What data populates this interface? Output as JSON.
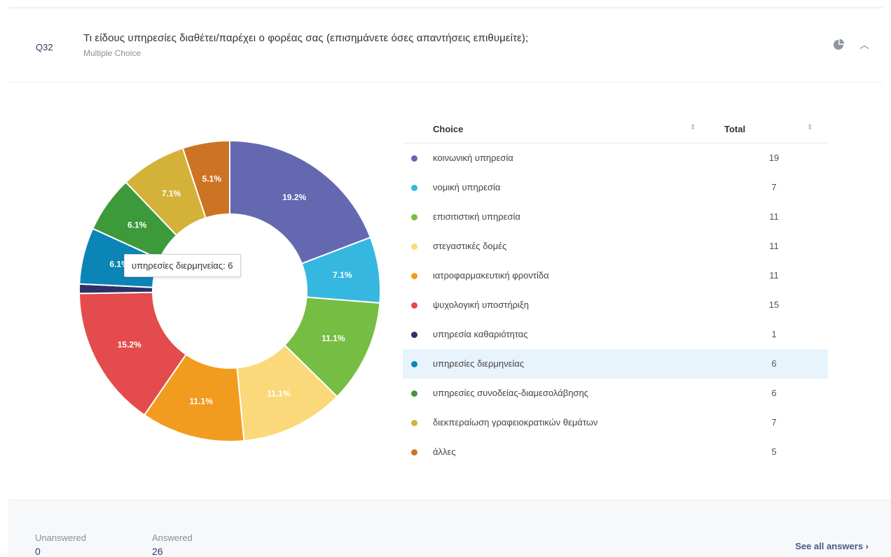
{
  "question": {
    "number": "Q32",
    "title": "Τι είδους υπηρεσίες διαθέτει/παρέχει ο φορέας σας (επισημάνετε όσες απαντήσεις επιθυμείτε);",
    "type": "Multiple Choice",
    "icons": [
      "pie-chart-icon",
      "chevron-up-icon"
    ]
  },
  "table": {
    "header_choice": "Choice",
    "header_total": "Total",
    "sort_glyph": "⇕",
    "rows": [
      {
        "label": "κοινωνική υπηρεσία",
        "total": "19",
        "color": "#6468b0"
      },
      {
        "label": "νομική υπηρεσία",
        "total": "7",
        "color": "#36b7e0"
      },
      {
        "label": "επισιτιστική υπηρεσία",
        "total": "11",
        "color": "#76bd43"
      },
      {
        "label": "στεγαστικές δομές",
        "total": "11",
        "color": "#fbd97a"
      },
      {
        "label": "ιατροφαρμακευτική φροντίδα",
        "total": "11",
        "color": "#f29c1f"
      },
      {
        "label": "ψυχολογική υποστήριξη",
        "total": "15",
        "color": "#e44b4c"
      },
      {
        "label": "υπηρεσία καθαριότητας",
        "total": "1",
        "color": "#2c3168"
      },
      {
        "label": "υπηρεσίες διερμηνείας",
        "total": "6",
        "color": "#0b85b5",
        "highlighted": true
      },
      {
        "label": "υπηρεσίες συνοδείας-διαμεσολάβησης",
        "total": "6",
        "color": "#3d9a3a"
      },
      {
        "label": "διεκπεραίωση γραφειοκρατικών θεμάτων",
        "total": "7",
        "color": "#d4b23a"
      },
      {
        "label": "άλλες",
        "total": "5",
        "color": "#cc7424"
      }
    ]
  },
  "tooltip": "υπηρεσίες διερμηνείας: 6",
  "footer": {
    "unanswered_label": "Unanswered",
    "unanswered_value": "0",
    "answered_label": "Answered",
    "answered_value": "26",
    "see_all": "See all answers ›"
  },
  "chart_data": {
    "type": "pie",
    "donut": true,
    "categories": [
      "κοινωνική υπηρεσία",
      "νομική υπηρεσία",
      "επισιτιστική υπηρεσία",
      "στεγαστικές δομές",
      "ιατροφαρμακευτική φροντίδα",
      "ψυχολογική υποστήριξη",
      "υπηρεσία καθαριότητας",
      "υπηρεσίες διερμηνείας",
      "υπηρεσίες συνοδείας-διαμεσολάβησης",
      "διεκπεραίωση γραφειοκρατικών θεμάτων",
      "άλλες"
    ],
    "values": [
      19,
      7,
      11,
      11,
      11,
      15,
      1,
      6,
      6,
      7,
      5
    ],
    "data_labels": [
      "19.2%",
      "7.1%",
      "11.1%",
      "11.1%",
      "11.1%",
      "15.2%",
      "",
      "6.1%",
      "6.1%",
      "7.1%",
      "5.1%"
    ],
    "colors": [
      "#6468b0",
      "#36b7e0",
      "#76bd43",
      "#fbd97a",
      "#f29c1f",
      "#e44b4c",
      "#2c3168",
      "#0b85b5",
      "#3d9a3a",
      "#d4b23a",
      "#cc7424"
    ]
  }
}
